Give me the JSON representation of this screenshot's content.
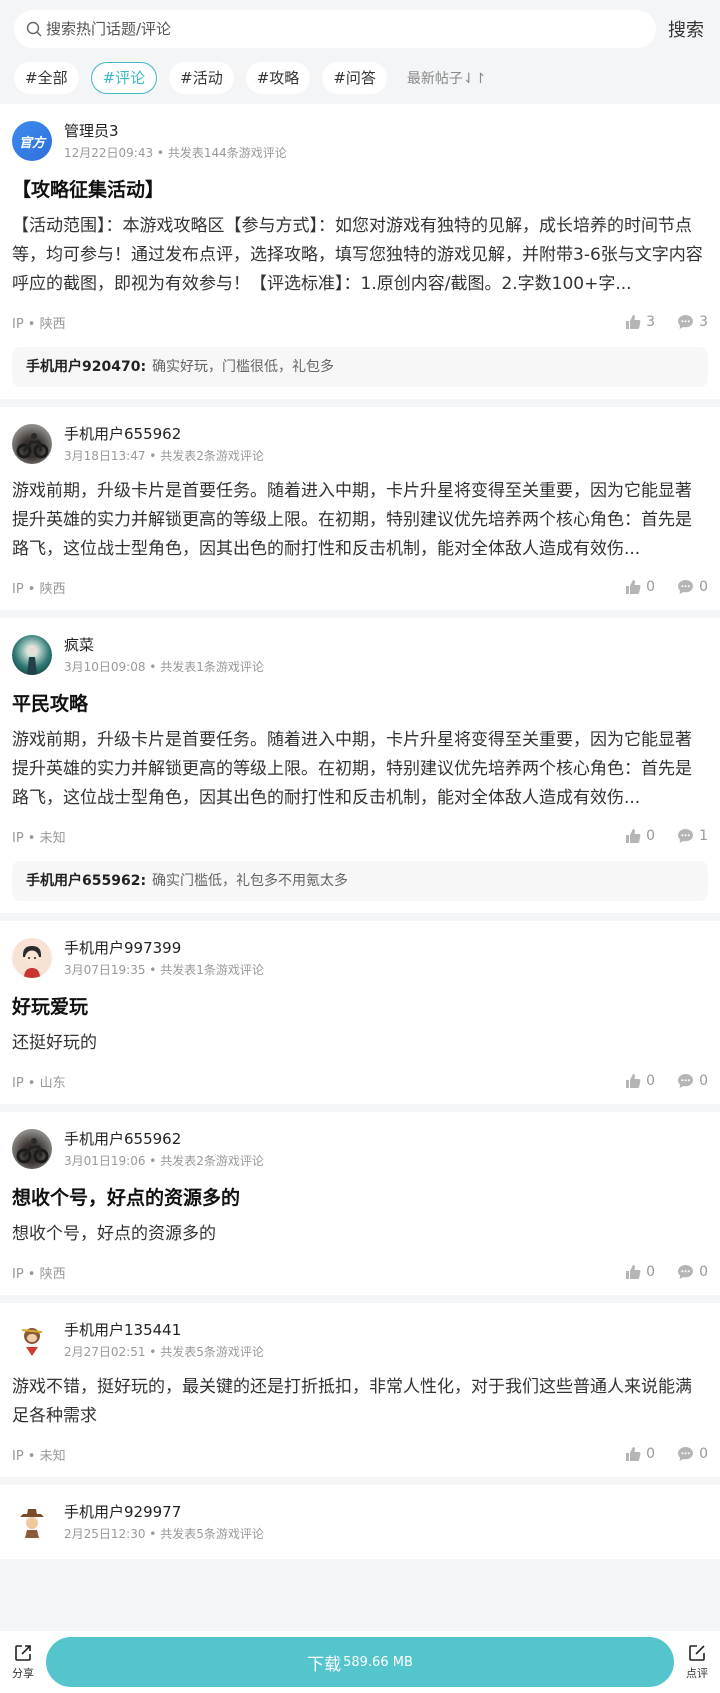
{
  "search": {
    "placeholder": "搜索热门话题/评论",
    "button": "搜索"
  },
  "tabs": [
    "#全部",
    "#评论",
    "#活动",
    "#攻略",
    "#问答"
  ],
  "sort_label": "最新帖子⇃↾",
  "posts": [
    {
      "avatar_text": "官方",
      "username": "管理员3",
      "meta": "12月22日09:43 • 共发表144条游戏评论",
      "title": "【攻略征集活动】",
      "body": "【活动范围】：本游戏攻略区【参与方式】：如您对游戏有独特的见解，成长培养的时间节点等，均可参与！通过发布点评，选择攻略，填写您独特的游戏见解，并附带3-6张与文字内容呼应的截图，即视为有效参与！【评选标准】：1.原创内容/截图。2.字数100+字...",
      "ip": "IP • 陕西",
      "likes": "3",
      "comments": "3",
      "reply_user": "手机用户920470:",
      "reply_text": "确实好玩，门槛很低，礼包多"
    },
    {
      "username": "手机用户655962",
      "meta": "3月18日13:47 • 共发表2条游戏评论",
      "body": "游戏前期，升级卡片是首要任务。随着进入中期，卡片升星将变得至关重要，因为它能显著提升英雄的实力并解锁更高的等级上限。在初期，特别建议优先培养两个核心角色：首先是路飞，这位战士型角色，因其出色的耐打性和反击机制，能对全体敌人造成有效伤...",
      "ip": "IP • 陕西",
      "likes": "0",
      "comments": "0"
    },
    {
      "username": "疯菜",
      "meta": "3月10日09:08 • 共发表1条游戏评论",
      "title": "平民攻略",
      "body": "游戏前期，升级卡片是首要任务。随着进入中期，卡片升星将变得至关重要，因为它能显著提升英雄的实力并解锁更高的等级上限。在初期，特别建议优先培养两个核心角色：首先是路飞，这位战士型角色，因其出色的耐打性和反击机制，能对全体敌人造成有效伤...",
      "ip": "IP • 未知",
      "likes": "0",
      "comments": "1",
      "reply_user": "手机用户655962:",
      "reply_text": "确实门槛低，礼包多不用氪太多"
    },
    {
      "username": "手机用户997399",
      "meta": "3月07日19:35 • 共发表1条游戏评论",
      "title": "好玩爱玩",
      "body": "还挺好玩的",
      "ip": "IP • 山东",
      "likes": "0",
      "comments": "0"
    },
    {
      "username": "手机用户655962",
      "meta": "3月01日19:06 • 共发表2条游戏评论",
      "title": "想收个号，好点的资源多的",
      "body": "想收个号，好点的资源多的",
      "ip": "IP • 陕西",
      "likes": "0",
      "comments": "0"
    },
    {
      "username": "手机用户135441",
      "meta": "2月27日02:51 • 共发表5条游戏评论",
      "body": "游戏不错，挺好玩的，最关键的还是打折抵扣，非常人性化，对于我们这些普通人来说能满足各种需求",
      "ip": "IP • 未知",
      "likes": "0",
      "comments": "0"
    },
    {
      "username": "手机用户929977",
      "meta": "2月25日12:30 • 共发表5条游戏评论"
    }
  ],
  "bottom": {
    "share": "分享",
    "download": "下载",
    "size": "589.66 MB",
    "review": "点评"
  },
  "colors": {
    "accent": "#3fb9c3",
    "download": "#54c4cd",
    "official": "#2e6fd9"
  }
}
